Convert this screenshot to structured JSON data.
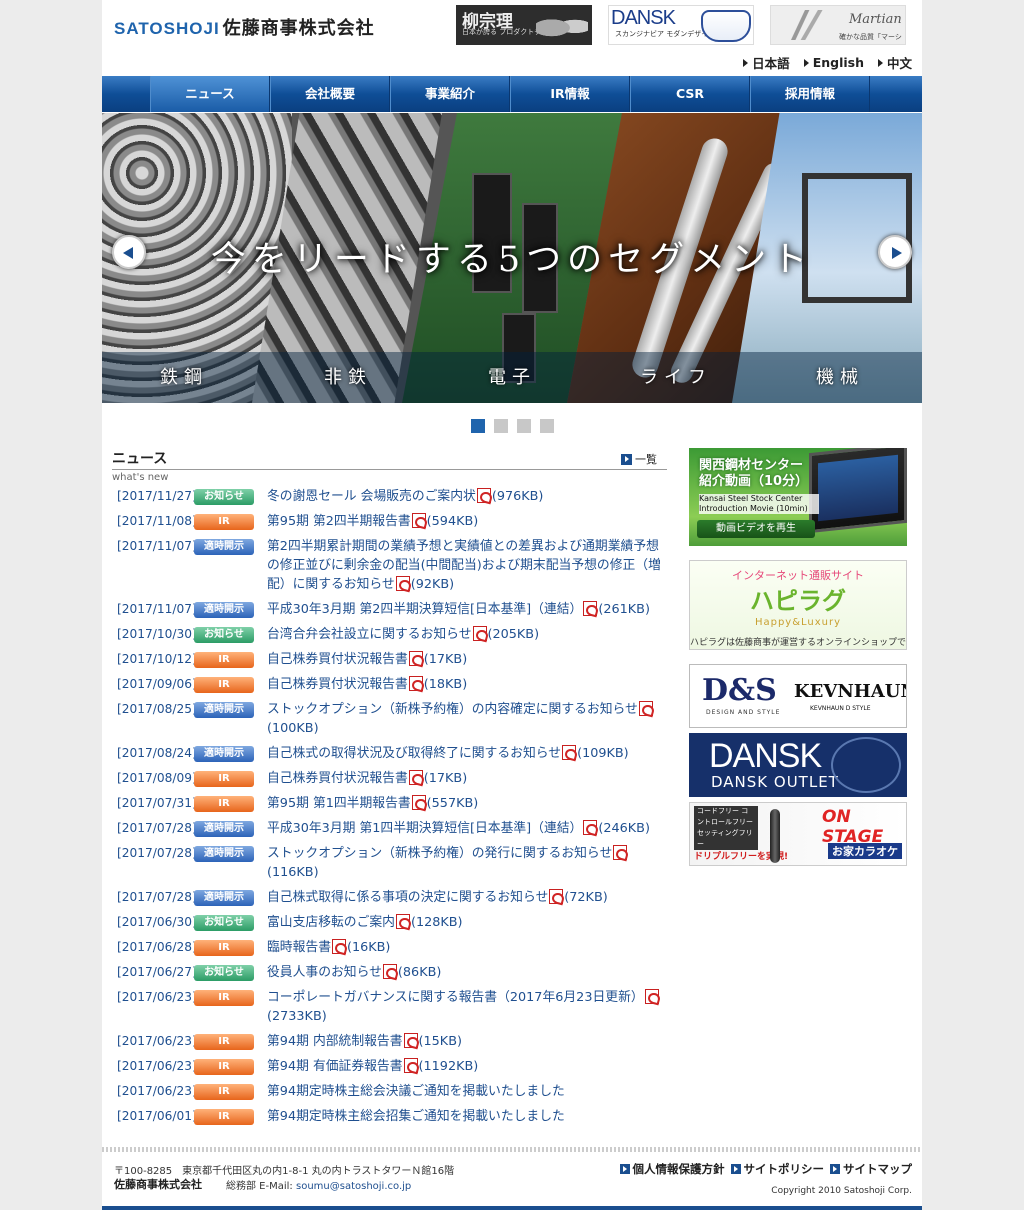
{
  "header": {
    "logo_en": "SATOSHOJI",
    "logo_jp": "佐藤商事株式会社",
    "brands": {
      "yanagi": {
        "title": "柳宗理",
        "caption": "日本が誇る プロダクトデザイナー"
      },
      "dansk": {
        "title": "DANSK",
        "caption": "スカンジナビア モダンデザイン"
      },
      "martian": {
        "title": "Martian",
        "caption": "確かな品質「マーシャン」"
      }
    },
    "languages": [
      "日本語",
      "English",
      "中文"
    ]
  },
  "nav": [
    "ニュース",
    "会社概要",
    "事業紹介",
    "IR情報",
    "CSR",
    "採用情報"
  ],
  "hero": {
    "title": "今をリードする5つのセグメント",
    "segments": [
      "鉄鋼",
      "非鉄",
      "電子",
      "ライフ",
      "機械"
    ],
    "slides_total": 4,
    "active_slide": 1
  },
  "news": {
    "heading": "ニュース",
    "subheading": "what's new",
    "all_label": "一覧",
    "badge_labels": {
      "oshirase": "お知らせ",
      "ir": "IR",
      "tekiji": "適時開示"
    },
    "items": [
      {
        "date": "[2017/11/27]",
        "type": "oshirase",
        "title": "冬の謝恩セール 会場販売のご案内状",
        "size": "(976KB)"
      },
      {
        "date": "[2017/11/08]",
        "type": "ir",
        "title": "第95期 第2四半期報告書",
        "size": "(594KB)"
      },
      {
        "date": "[2017/11/07]",
        "type": "tekiji",
        "title": "第2四半期累計期間の業績予想と実績値との差異および通期業績予想の修正並びに剰余金の配当(中間配当)および期末配当予想の修正（増配）に関するお知らせ",
        "size": "(92KB)"
      },
      {
        "date": "[2017/11/07]",
        "type": "tekiji",
        "title": "平成30年3月期 第2四半期決算短信[日本基準]（連結）",
        "size": "(261KB)"
      },
      {
        "date": "[2017/10/30]",
        "type": "oshirase",
        "title": "台湾合弁会社設立に関するお知らせ",
        "size": "(205KB)"
      },
      {
        "date": "[2017/10/12]",
        "type": "ir",
        "title": "自己株券買付状況報告書",
        "size": "(17KB)"
      },
      {
        "date": "[2017/09/06]",
        "type": "ir",
        "title": "自己株券買付状況報告書",
        "size": "(18KB)"
      },
      {
        "date": "[2017/08/25]",
        "type": "tekiji",
        "title": "ストックオプション（新株予約権）の内容確定に関するお知らせ",
        "size": "(100KB)"
      },
      {
        "date": "[2017/08/24]",
        "type": "tekiji",
        "title": "自己株式の取得状況及び取得終了に関するお知らせ",
        "size": "(109KB)"
      },
      {
        "date": "[2017/08/09]",
        "type": "ir",
        "title": "自己株券買付状況報告書",
        "size": "(17KB)"
      },
      {
        "date": "[2017/07/31]",
        "type": "ir",
        "title": "第95期 第1四半期報告書",
        "size": "(557KB)"
      },
      {
        "date": "[2017/07/28]",
        "type": "tekiji",
        "title": "平成30年3月期 第1四半期決算短信[日本基準]（連結）",
        "size": "(246KB)"
      },
      {
        "date": "[2017/07/28]",
        "type": "tekiji",
        "title": "ストックオプション（新株予約権）の発行に関するお知らせ",
        "size": "(116KB)"
      },
      {
        "date": "[2017/07/28]",
        "type": "tekiji",
        "title": "自己株式取得に係る事項の決定に関するお知らせ",
        "size": "(72KB)"
      },
      {
        "date": "[2017/06/30]",
        "type": "oshirase",
        "title": "富山支店移転のご案内",
        "size": "(128KB)"
      },
      {
        "date": "[2017/06/28]",
        "type": "ir",
        "title": "臨時報告書",
        "size": "(16KB)"
      },
      {
        "date": "[2017/06/27]",
        "type": "oshirase",
        "title": "役員人事のお知らせ",
        "size": "(86KB)"
      },
      {
        "date": "[2017/06/23]",
        "type": "ir",
        "title": "コーポレートガバナンスに関する報告書（2017年6月23日更新）",
        "size": "(2733KB)"
      },
      {
        "date": "[2017/06/23]",
        "type": "ir",
        "title": "第94期 内部統制報告書",
        "size": "(15KB)"
      },
      {
        "date": "[2017/06/23]",
        "type": "ir",
        "title": "第94期 有価証券報告書",
        "size": "(1192KB)"
      },
      {
        "date": "[2017/06/23]",
        "type": "ir",
        "title": "第94期定時株主総会決議ご通知を掲載いたしました",
        "size": ""
      },
      {
        "date": "[2017/06/01]",
        "type": "ir",
        "title": "第94期定時株主総会招集ご通知を掲載いたしました",
        "size": ""
      }
    ]
  },
  "sidebar": {
    "video": {
      "title": "関西鋼材センター 紹介動画（10分）",
      "title_en": "Kansai Steel Stock Center Introduction Movie (10min)",
      "button": "動画ビデオを再生"
    },
    "hapirag": {
      "lead": "インターネット通販サイト",
      "name": "ハピラグ",
      "tagline": "Happy&Luxury",
      "desc": "ハピラグは佐藤商事が運営するオンラインショップです。"
    },
    "ds": {
      "logo": "D&S",
      "logo_sub": "DESIGN AND STYLE",
      "brand": "KEVNHAUN",
      "brand_sub": "KEVNHAUN D STYLE"
    },
    "outlet": {
      "title": "DANSK",
      "sub": "DANSK OUTLET"
    },
    "karaoke": {
      "tag": "コードフリー コントロールフリー セッティングフリー",
      "note": "ドリプルフリーを実現!",
      "brand": "ON STAGE",
      "sub": "お家カラオケ"
    }
  },
  "footer": {
    "address": "〒100-8285　東京都千代田区丸の内1-8-1 丸の内トラストタワーＮ館16階",
    "company": "佐藤商事株式会社",
    "email_label": "総務部 E-Mail:",
    "email": "soumu@satoshoji.co.jp",
    "links": [
      "個人情報保護方針",
      "サイトポリシー",
      "サイトマップ"
    ],
    "copyright": "Copyright 2010 Satoshoji Corp."
  },
  "colors": {
    "accent": "#1f64ad",
    "nav": "#0f4e97",
    "link": "#1f4f8f"
  }
}
